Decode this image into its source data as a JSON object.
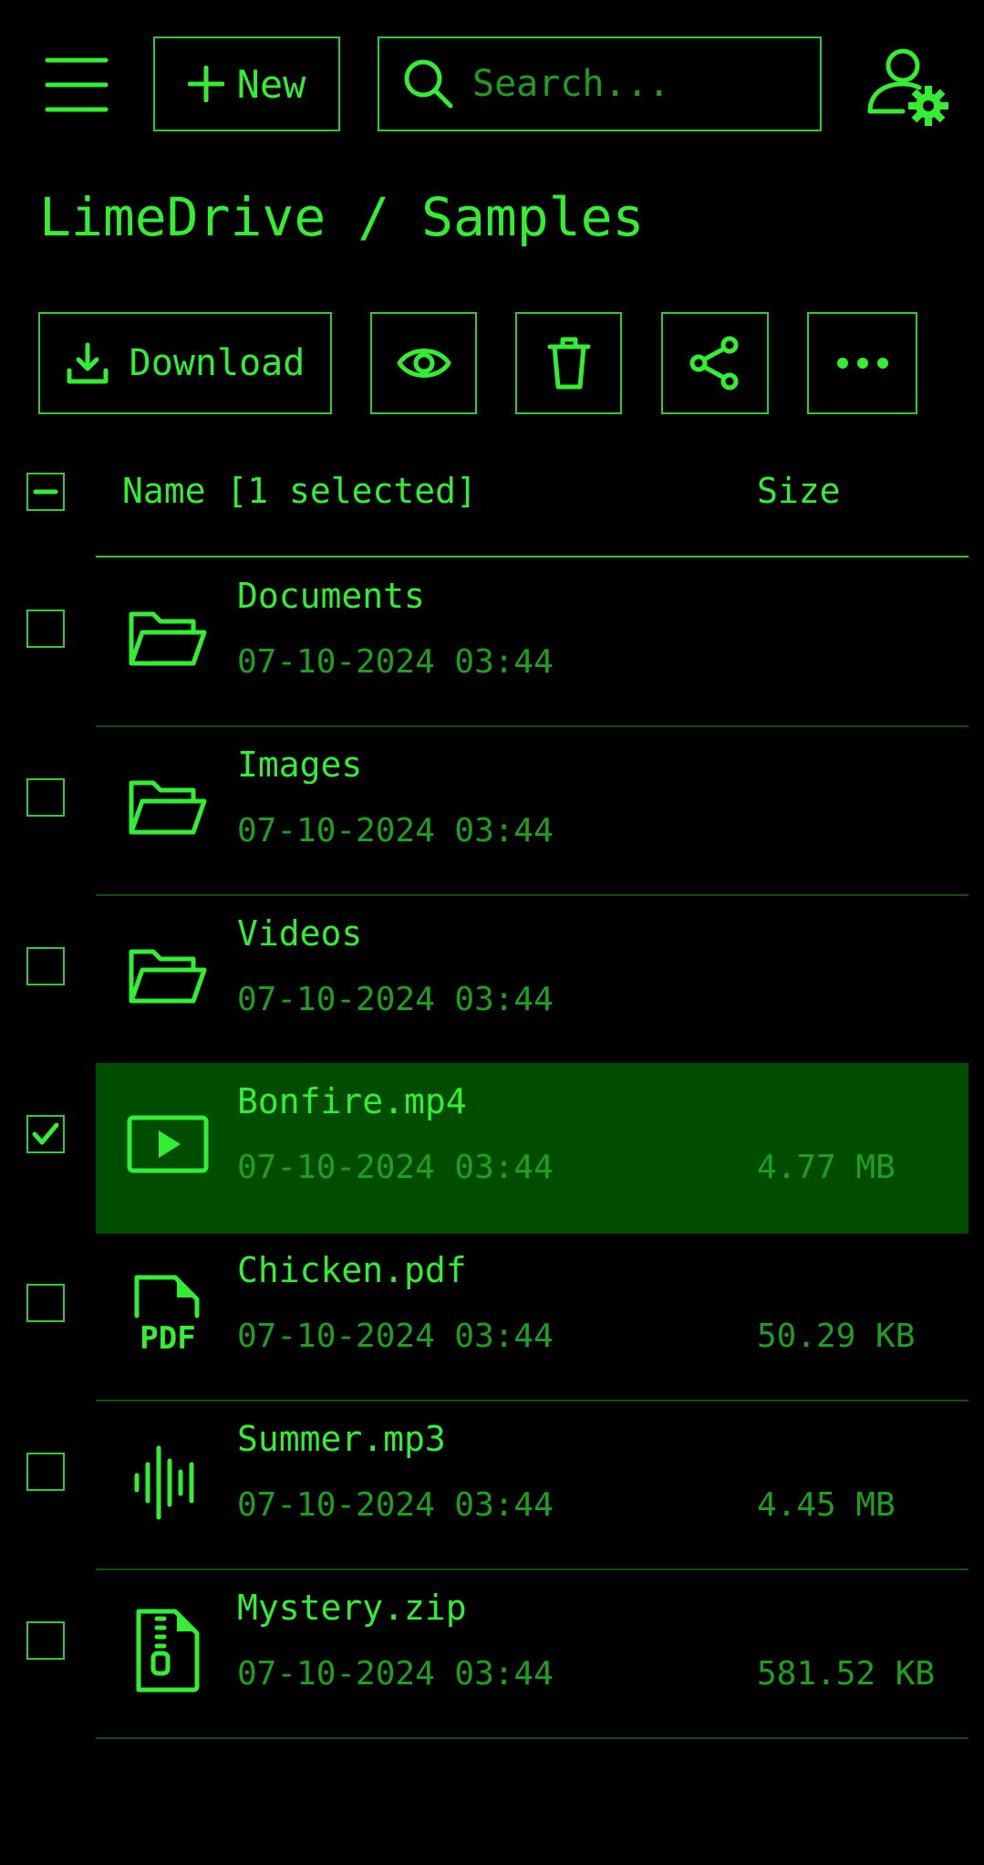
{
  "topbar": {
    "menu_icon": "hamburger-menu-icon",
    "new_label": "New",
    "search_placeholder": "Search...",
    "user_icon": "user-settings-icon"
  },
  "breadcrumb": "LimeDrive / Samples",
  "toolbar": {
    "download_label": "Download",
    "icons": [
      "download-icon",
      "eye-icon",
      "trash-icon",
      "share-icon",
      "more-dots-icon"
    ]
  },
  "table": {
    "name_header": "Name [1 selected]",
    "size_header": "Size",
    "rows": [
      {
        "name": "Documents",
        "date": "07-10-2024 03:44",
        "size": "",
        "type": "folder",
        "selected": false
      },
      {
        "name": "Images",
        "date": "07-10-2024 03:44",
        "size": "",
        "type": "folder",
        "selected": false
      },
      {
        "name": "Videos",
        "date": "07-10-2024 03:44",
        "size": "",
        "type": "folder",
        "selected": false
      },
      {
        "name": "Bonfire.mp4",
        "date": "07-10-2024 03:44",
        "size": "4.77 MB",
        "type": "video",
        "selected": true
      },
      {
        "name": "Chicken.pdf",
        "date": "07-10-2024 03:44",
        "size": "50.29 KB",
        "type": "pdf",
        "selected": false
      },
      {
        "name": "Summer.mp3",
        "date": "07-10-2024 03:44",
        "size": "4.45 MB",
        "type": "audio",
        "selected": false
      },
      {
        "name": "Mystery.zip",
        "date": "07-10-2024 03:44",
        "size": "581.52 KB",
        "type": "zip",
        "selected": false
      }
    ],
    "pdf_icon_text": "PDF"
  },
  "colors": {
    "accent": "#33ee33",
    "muted": "#1ea01e",
    "selected_bg": "#004d00",
    "background": "#000000"
  }
}
